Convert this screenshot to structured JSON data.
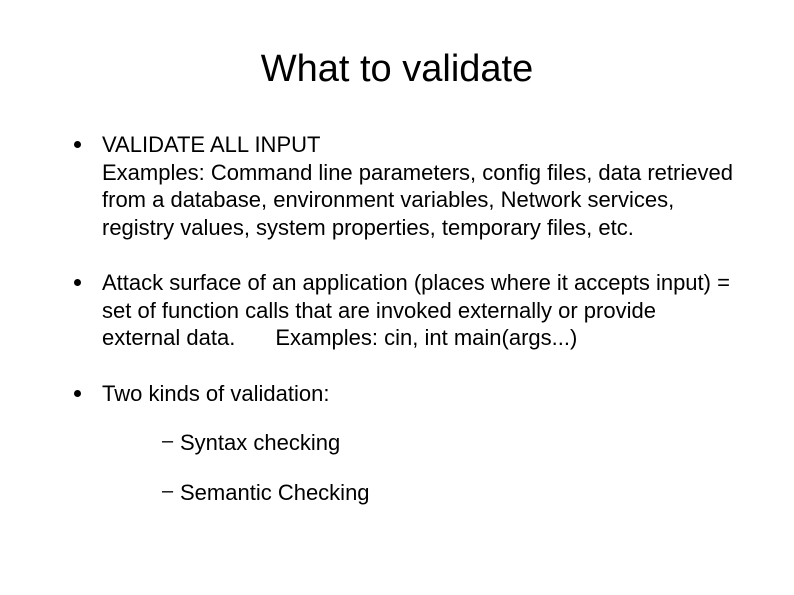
{
  "title": "What to validate",
  "bullets": [
    {
      "text": "VALIDATE ALL INPUT\nExamples: Command line parameters, config files, data retrieved from a database, environment variables, Network services, registry values, system properties, temporary files, etc."
    },
    {
      "text_a": "Attack surface of an application (places where it accepts input) = set of function calls that are invoked externally or provide external data.",
      "text_b": "Examples: cin, int main(args...)"
    },
    {
      "text": "Two kinds of validation:",
      "sub": [
        "Syntax checking",
        "Semantic Checking"
      ]
    }
  ]
}
